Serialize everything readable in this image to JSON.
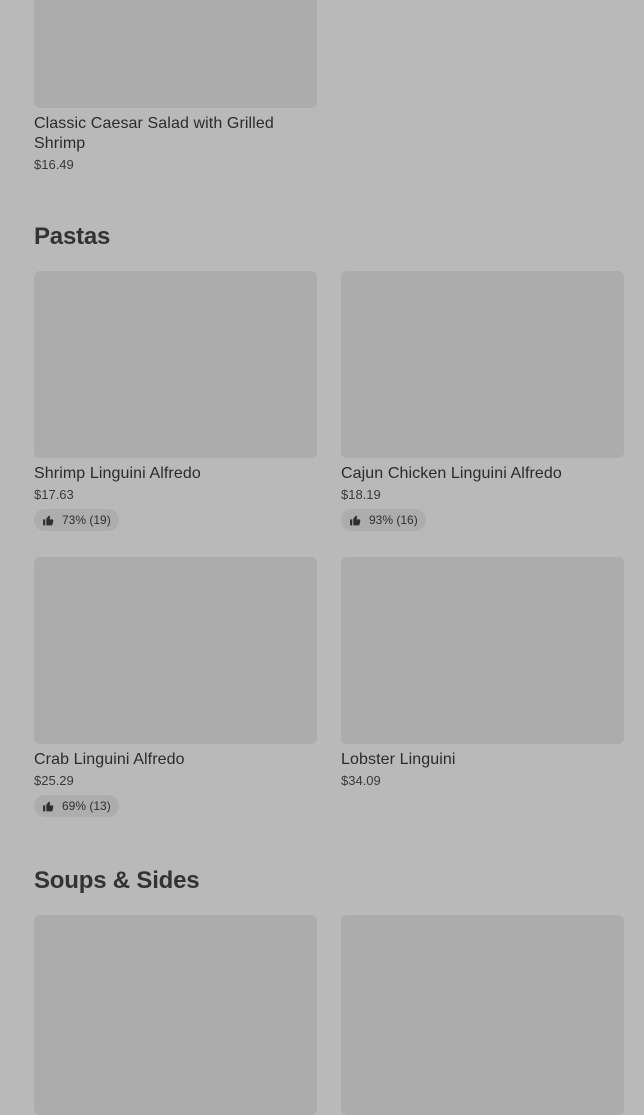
{
  "colors": {
    "background": "#b9b9b9",
    "image_placeholder": "#acacac",
    "rating_pill": "#adadad",
    "text": "#2b2b2b"
  },
  "top_item": {
    "name": "Classic Caesar Salad with Grilled Shrimp",
    "price": "$16.49"
  },
  "sections": [
    {
      "title": "Pastas",
      "items": [
        {
          "name": "Shrimp Linguini Alfredo",
          "price": "$17.63",
          "rating": "73% (19)",
          "rating_icon": "thumbs-up-icon"
        },
        {
          "name": "Cajun Chicken Linguini Alfredo",
          "price": "$18.19",
          "rating": "93% (16)",
          "rating_icon": "thumbs-up-icon"
        },
        {
          "name": "Crab Linguini Alfredo",
          "price": "$25.29",
          "rating": "69% (13)",
          "rating_icon": "thumbs-up-icon"
        },
        {
          "name": "Lobster Linguini",
          "price": "$34.09"
        }
      ]
    },
    {
      "title": "Soups & Sides",
      "items": []
    }
  ]
}
